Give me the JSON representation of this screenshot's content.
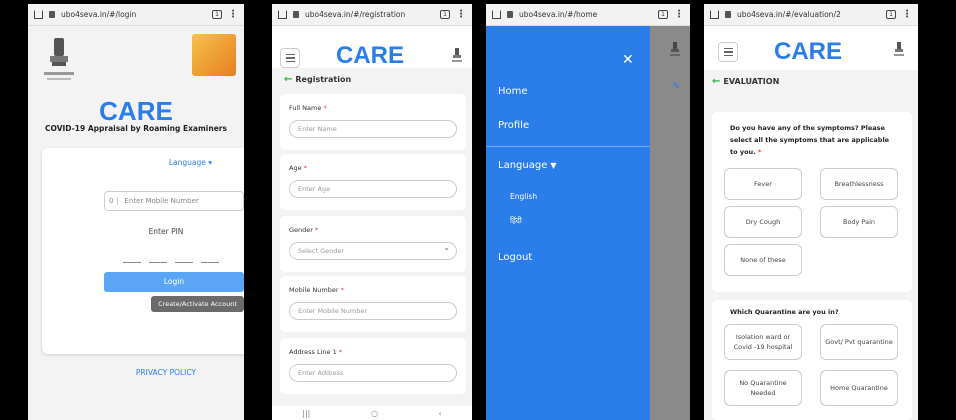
{
  "screens": {
    "login": {
      "url": "ubo4seva.in/#/login",
      "title": "CARE",
      "subtitle": "COVID-19 Appraisal by Roaming Examiners",
      "language_label": "Language",
      "mobile_prefix": "0",
      "mobile_placeholder": "Enter Mobile Number",
      "pin_label": "Enter PIN",
      "login_button": "Login",
      "create_button": "Create/Activate Account",
      "privacy_link": "PRIVACY POLICY"
    },
    "registration": {
      "url": "ubo4seva.in/#/registration",
      "title": "CARE",
      "back_label": "Registration",
      "fields": [
        {
          "label": "Full Name",
          "placeholder": "Enter Name"
        },
        {
          "label": "Age",
          "placeholder": "Enter Age"
        },
        {
          "label": "Gender",
          "placeholder": "Select Gender"
        },
        {
          "label": "Mobile Number",
          "placeholder": "Enter Mobile Number"
        },
        {
          "label": "Address Line 1",
          "placeholder": "Enter Address"
        }
      ]
    },
    "menu": {
      "url": "ubo4seva.in/#/home",
      "items": [
        "Home",
        "Profile",
        "Language",
        "Logout"
      ],
      "languages": [
        "English",
        "हिंदी"
      ]
    },
    "evaluation": {
      "url": "ubo4seva.in/#/evaluation/2",
      "title": "CARE",
      "back_label": "EVALUATION",
      "q1": "Do you have any of the symptoms? Please select all the symptoms that are applicable to you.",
      "q1_options": [
        "Fever",
        "Breathlessness",
        "Dry Cough",
        "Body Pain",
        "None of these"
      ],
      "q2": "Which Quarantine are you in?",
      "q2_options": [
        "Isolation ward or Covid -19 hospital",
        "Govt/ Pvt quarantine",
        "No Quarantine Needed",
        "Home Quarantine"
      ]
    }
  },
  "colors": {
    "primary": "#2b7de9",
    "button": "#5aa6f5",
    "required": "#e33"
  }
}
